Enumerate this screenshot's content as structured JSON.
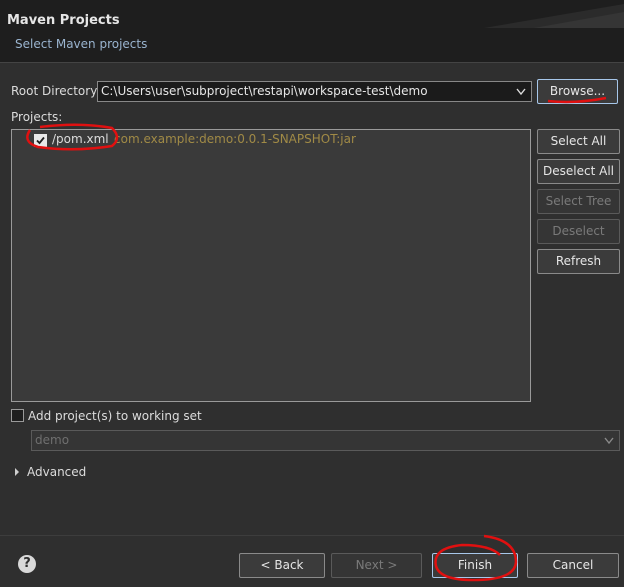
{
  "header": {
    "title": "Maven Projects",
    "subtitle": "Select Maven projects"
  },
  "root_directory": {
    "label": "Root Directory:",
    "value": "C:\\Users\\user\\subproject\\restapi\\workspace-test\\demo",
    "browse_label": "Browse..."
  },
  "projects": {
    "label": "Projects:",
    "items": [
      {
        "name": "/pom.xml",
        "artifact": "com.example:demo:0.0.1-SNAPSHOT:jar",
        "checked": true
      }
    ]
  },
  "side_buttons": {
    "select_all": "Select All",
    "deselect_all": "Deselect All",
    "select_tree": "Select Tree",
    "deselect_tree": "Deselect Tree",
    "refresh": "Refresh"
  },
  "working_set": {
    "checkbox_label": "Add project(s) to working set",
    "combo_value": "demo",
    "checked": false
  },
  "advanced": {
    "label": "Advanced"
  },
  "footer": {
    "back": "< Back",
    "next": "Next >",
    "finish": "Finish",
    "cancel": "Cancel"
  },
  "colors": {
    "annotation": "#e01010",
    "artifact_text": "#a08a46",
    "focus_border": "#a7c7ea"
  },
  "icons": [
    "help-icon",
    "dropdown-arrow-icon",
    "expand-triangle-icon",
    "checkmark-icon"
  ]
}
